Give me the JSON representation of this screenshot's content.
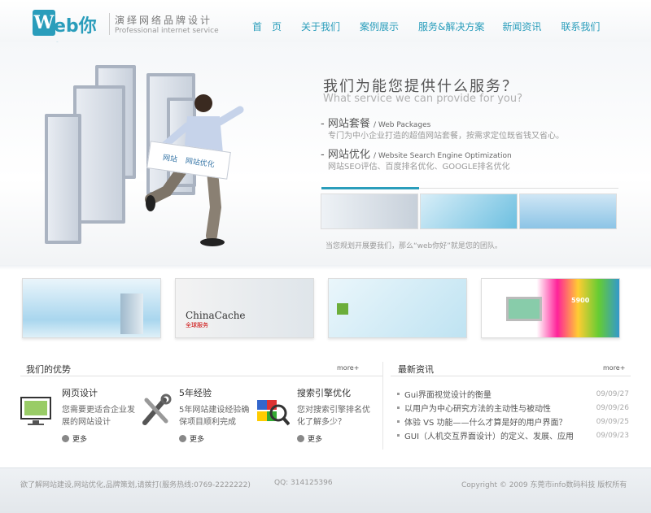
{
  "header": {
    "logo_mark": "W",
    "logo_mark2": "eb你好",
    "logo_cn": "演绎网络品牌设计",
    "logo_en": "Professional internet service",
    "nav": [
      "首　页",
      "关于我们",
      "案例展示",
      "服务&解决方案",
      "新闻资讯",
      "联系我们"
    ]
  },
  "hero": {
    "title": "我们为能您提供什么服务？",
    "subtitle": "What service we can provide for you?",
    "service1_title": "- 网站套餐",
    "service1_en": "/ Web Packages",
    "service1_desc": "专门为中小企业打造的超值网站套餐，按需求定位既省钱又省心。",
    "service2_title": "- 网站优化",
    "service2_en": "/ Website Search Engine Optimization",
    "service2_desc": "网站SEO评估、百度排名优化、GOOGLE排名优化",
    "sign_text": "网站",
    "sign_text2": "网站优化",
    "caption": "当您规划开展要我们，那么“web你好”就是您的团队。"
  },
  "banners": [
    {
      "label": ""
    },
    {
      "label": "ChinaCache",
      "sub": "全球服务"
    },
    {
      "label": ""
    },
    {
      "label": "5900"
    }
  ],
  "advantages": {
    "title": "我们的优势",
    "more": "more+",
    "items": [
      {
        "title": "网页设计",
        "desc": "您需要更适合企业发展的网站设计",
        "more": "更多"
      },
      {
        "title": "5年经验",
        "desc": "5年网站建设经验确保项目顺利完成",
        "more": "更多"
      },
      {
        "title": "搜索引擎优化",
        "desc": "您对搜索引擎排名优化了解多少？",
        "more": "更多"
      }
    ]
  },
  "news": {
    "title": "最新资讯",
    "more": "more+",
    "items": [
      {
        "t": "Gui界面视觉设计的衡量",
        "d": "09/09/27"
      },
      {
        "t": "以用户为中心研究方法的主动性与被动性",
        "d": "09/09/26"
      },
      {
        "t": "体验 VS 功能——什么才算是好的用户界面？",
        "d": "09/09/25"
      },
      {
        "t": "GUI（人机交互界面设计）的定义、发展、应用",
        "d": "09/09/23"
      }
    ]
  },
  "footer": {
    "left": "欲了解网站建设,网站优化,品牌策划,请拨打(服务热线:0769-2222222)",
    "qq": "QQ: 314125396",
    "right": "Copyright © 2009 东莞市info数码科技 版权所有"
  },
  "colors": {
    "accent": "#2a9dbb"
  }
}
